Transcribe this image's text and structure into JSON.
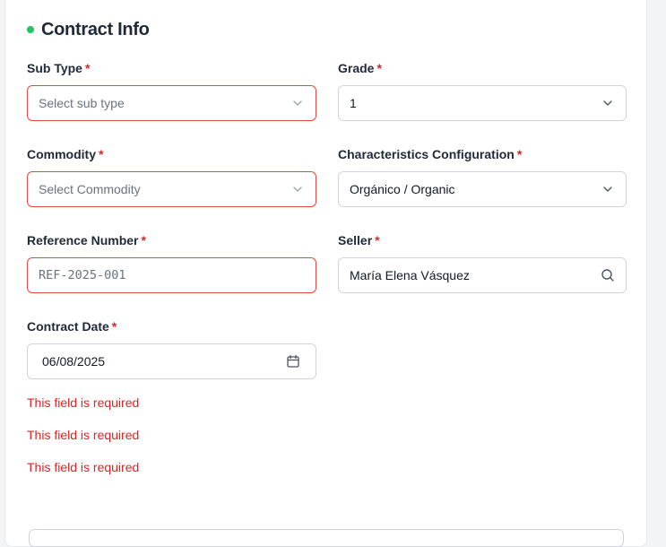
{
  "section": {
    "title": "Contract Info",
    "dot_color": "#22c55e"
  },
  "required_marker": "*",
  "fields": {
    "sub_type": {
      "label": "Sub Type",
      "placeholder": "Select sub type"
    },
    "grade": {
      "label": "Grade",
      "value": "1"
    },
    "commodity": {
      "label": "Commodity",
      "placeholder": "Select Commodity"
    },
    "characteristics": {
      "label": "Characteristics Configuration",
      "value": "Orgánico / Organic"
    },
    "reference_number": {
      "label": "Reference Number",
      "placeholder": "REF-2025-001"
    },
    "seller": {
      "label": "Seller",
      "value": "María Elena Vásquez"
    },
    "contract_date": {
      "label": "Contract Date",
      "value": "06/08/2025"
    }
  },
  "errors": [
    "This field is required",
    "This field is required",
    "This field is required"
  ],
  "colors": {
    "error": "#dc2626",
    "error_border": "#dc4a4a",
    "border": "#d1d5db"
  }
}
